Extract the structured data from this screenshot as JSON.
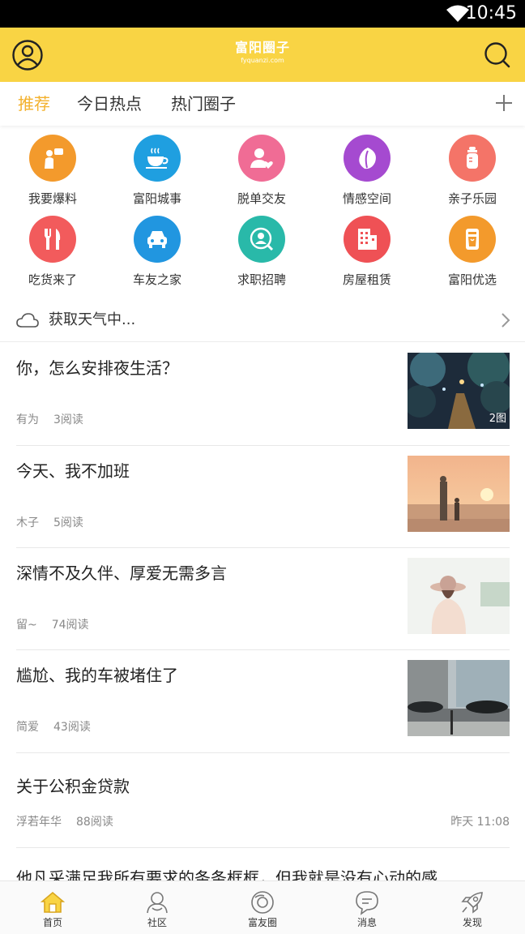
{
  "status": {
    "time": "10:45"
  },
  "header": {
    "logo_cn": "富阳圈子",
    "logo_en": "fyquanzi.com"
  },
  "tabs": [
    {
      "label": "推荐",
      "active": true
    },
    {
      "label": "今日热点",
      "active": false
    },
    {
      "label": "热门圈子",
      "active": false
    }
  ],
  "categories": [
    {
      "label": "我要爆料",
      "icon": "megaphone-person-icon",
      "color": "#f39a2c"
    },
    {
      "label": "富阳城事",
      "icon": "coffee-cup-icon",
      "color": "#1f9fe0"
    },
    {
      "label": "脱单交友",
      "icon": "heart-person-icon",
      "color": "#f06c95"
    },
    {
      "label": "情感空间",
      "icon": "leaf-icon",
      "color": "#a54ad0"
    },
    {
      "label": "亲子乐园",
      "icon": "baby-bottle-icon",
      "color": "#f47468"
    },
    {
      "label": "吃货来了",
      "icon": "fork-knife-icon",
      "color": "#f25b5c"
    },
    {
      "label": "车友之家",
      "icon": "car-icon",
      "color": "#2196e0"
    },
    {
      "label": "求职招聘",
      "icon": "job-search-icon",
      "color": "#29b9a9"
    },
    {
      "label": "房屋租赁",
      "icon": "building-icon",
      "color": "#ef5155"
    },
    {
      "label": "富阳优选",
      "icon": "shopping-cup-icon",
      "color": "#f39a2c"
    }
  ],
  "weather": {
    "text": "获取天气中..."
  },
  "feed": [
    {
      "title": "你，怎么安排夜生活？",
      "author": "有为",
      "reads": "3阅读",
      "badge": "2图",
      "image": "night-garden-path"
    },
    {
      "title": "今天、我不加班",
      "author": "木子",
      "reads": "5阅读",
      "badge": "",
      "image": "sunset-beach-mother-child"
    },
    {
      "title": "深情不及久伴、厚爱无需多言",
      "author": "留~",
      "reads": "74阅读",
      "badge": "",
      "image": "girl-in-hat-backlit"
    },
    {
      "title": "尴尬、我的车被堵住了",
      "author": "简爱",
      "reads": "43阅读",
      "badge": "",
      "image": "city-street-cars"
    },
    {
      "title": "关于公积金贷款",
      "author": "浮若年华",
      "reads": "88阅读",
      "time": "昨天 11:08"
    }
  ],
  "cutoff_title": "他凡采满足我所有要求的条条框框，但我就是没有心动的感",
  "bottom_nav": [
    {
      "label": "首页",
      "icon": "home-icon",
      "active": true
    },
    {
      "label": "社区",
      "icon": "community-icon",
      "active": false
    },
    {
      "label": "富友圈",
      "icon": "friends-circle-icon",
      "active": false
    },
    {
      "label": "消息",
      "icon": "message-icon",
      "active": false
    },
    {
      "label": "发现",
      "icon": "rocket-icon",
      "active": false
    }
  ],
  "colors": {
    "brand_yellow": "#f9d444",
    "active_tab": "#f3b12d",
    "text": "#222222",
    "meta": "#888888"
  }
}
